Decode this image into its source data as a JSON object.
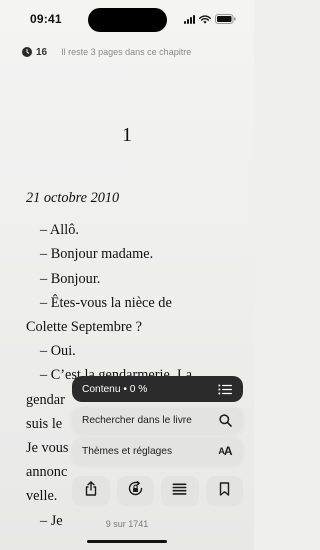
{
  "status_bar": {
    "time": "09:41"
  },
  "reading_header": {
    "minutes": "16",
    "remaining_text": "Il reste 3 pages dans ce chapitre"
  },
  "book": {
    "chapter_number": "1",
    "date": "21 octobre 2010",
    "lines": [
      {
        "text": "– Allô.",
        "indent": true
      },
      {
        "text": "– Bonjour madame.",
        "indent": true
      },
      {
        "text": "– Bonjour.",
        "indent": true
      },
      {
        "text": "– Êtes-vous la nièce de",
        "indent": true
      },
      {
        "text": "Colette Septembre ?",
        "indent": false
      },
      {
        "text": "– Oui.",
        "indent": true
      },
      {
        "text": "– C’est la gendarmerie. La",
        "indent": true
      },
      {
        "text": "gendar",
        "indent": false
      },
      {
        "text": "suis le",
        "indent": false
      },
      {
        "text": "Je vous",
        "indent": false
      },
      {
        "text": "annonc",
        "indent": false
      },
      {
        "text": "velle.",
        "indent": false
      },
      {
        "text": "– Je",
        "indent": true
      }
    ]
  },
  "menu": {
    "contents_label": "Contenu • 0 %",
    "search_label": "Rechercher dans le livre",
    "themes_label": "Thèmes et réglages",
    "themes_glyph_small": "A",
    "themes_glyph_large": "A"
  },
  "footer": {
    "page_indicator": "9 sur 1741"
  },
  "icons": {
    "contents": "list-icon",
    "search": "search-icon",
    "share": "share-icon",
    "rotation_lock": "rotation-lock-icon",
    "text_layout": "text-lines-icon",
    "bookmark": "bookmark-icon"
  }
}
